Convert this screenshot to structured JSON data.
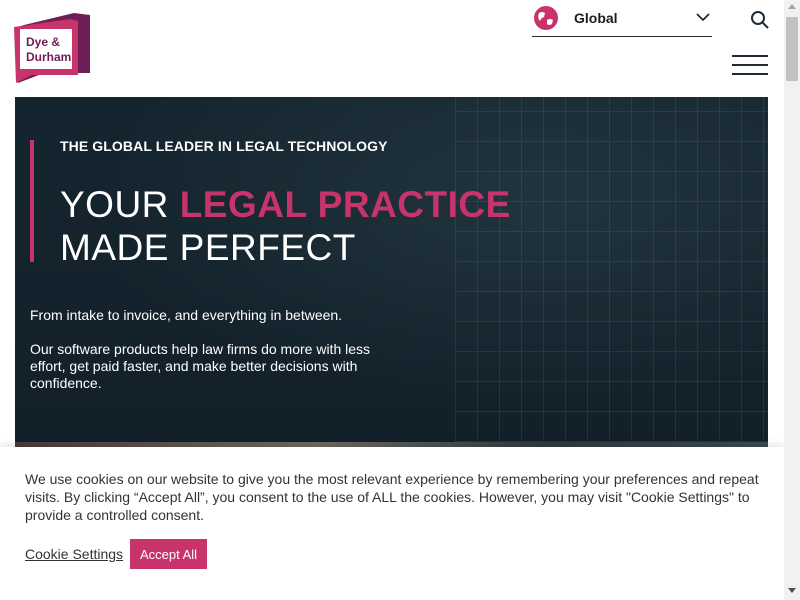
{
  "header": {
    "logo_line1": "Dye &",
    "logo_line2": "Durham",
    "region": {
      "label": "Global"
    }
  },
  "hero": {
    "eyebrow": "THE GLOBAL LEADER IN LEGAL TECHNOLOGY",
    "headline_part1": "YOUR ",
    "headline_accent": "LEGAL PRACTICE",
    "headline_line2": "MADE PERFECT",
    "subline": "From intake to invoice, and everything in between.",
    "body": "Our software products help law firms do more with less effort, get paid faster, and make better decisions with confidence."
  },
  "cookie": {
    "text": "We use cookies on our website to give you the most relevant experience by remembering your preferences and repeat visits. By clicking “Accept All”, you consent to the use of ALL the cookies. However, you may visit \"Cookie Settings\" to provide a controlled consent.",
    "settings_label": "Cookie Settings",
    "accept_label": "Accept All"
  },
  "colors": {
    "brand_pink": "#c8336b",
    "brand_purple": "#6d1f56",
    "hero_bg": "#14232d"
  }
}
